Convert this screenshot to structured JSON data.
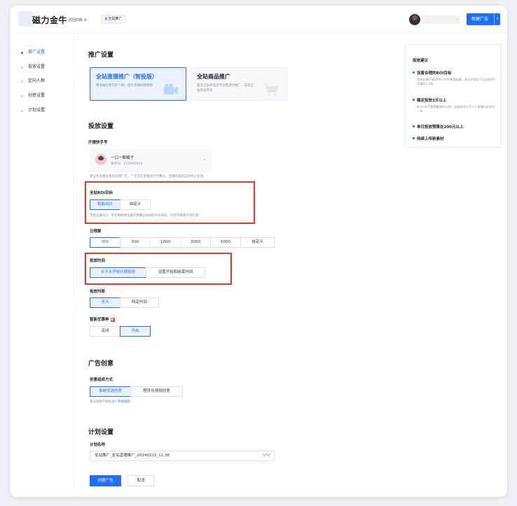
{
  "header": {
    "brand": "磁力金牛",
    "back_link": "返回旧版 ⇄",
    "mode_tag": "全站推广",
    "new_ad_label": "新建广告",
    "new_ad_caret": "▾",
    "user_caret": "⌄"
  },
  "sidebar": {
    "items": [
      {
        "label": "推广设置",
        "active": true
      },
      {
        "label": "投放设置"
      },
      {
        "label": "定向人群"
      },
      {
        "label": "创意设置"
      },
      {
        "label": "计划设置"
      }
    ]
  },
  "promo": {
    "heading": "推广设置",
    "card_live": {
      "title": "全站直播推广（智投版）",
      "desc": "精准触达意向买人群，提升直播间销售额"
    },
    "card_goods": {
      "title": "全站商品推广",
      "desc": "面向全站商品自然流量进行推广，提高全站商品转化"
    }
  },
  "delivery": {
    "heading": "投放设置",
    "account_label": "开播快手号",
    "account": {
      "name": "一口一颗橘子",
      "id": "快手ID：2139950/14"
    },
    "account_hint": "建议在直播前预先创建广告，广告仅在直播进行时曝光，直播结束后自动停止投放",
    "roi": {
      "label": "全站ROI目标",
      "options": [
        "智能出价",
        "自定义"
      ],
      "hint": "无需设置ROI，平台根据你设置的预算自动调控ROI目标，为你带来最大转化量"
    },
    "budget": {
      "label": "日预算",
      "options": [
        "300",
        "500",
        "1000",
        "3000",
        "5000",
        "自定义"
      ]
    },
    "time": {
      "label": "投放时间",
      "options": [
        "从今天开始长期投放",
        "设置开始和结束时间"
      ]
    },
    "period": {
      "label": "投放时段",
      "options": [
        "全天",
        "特定时间"
      ]
    },
    "coupon": {
      "label": "智能优惠券",
      "badge": "新",
      "options": [
        "关闭",
        "开启"
      ]
    }
  },
  "creative": {
    "heading": "广告创意",
    "mode_label": "创意组成方式",
    "options": [
      "系统优选创意",
      "程序化视频创意"
    ],
    "hint_prefix": "部分视频不想投放?",
    "hint_link": "手动排除"
  },
  "plan": {
    "heading": "计划设置",
    "name_label": "计划名称",
    "name_value": "全站推广_全站直播推广_20240315_11:36",
    "name_count": "0/50",
    "create_label": "创建广告",
    "cancel_label": "取消"
  },
  "tips": {
    "title": "投放建议",
    "items": [
      {
        "head": "设置合理的ROI目标",
        "body": "投放初期下调10%~20%更易起量，建议不超过7日全站ROI均值的1.2倍"
      },
      {
        "head": "稳定投放3天以上",
        "body": "前3小时不要频繁操作计划，且投放时长不少于直播总时长的一半"
      },
      {
        "head": "单日投放预算在200元以上",
        "body": ""
      },
      {
        "head": "持续上传新素材",
        "body": ""
      }
    ]
  },
  "colors": {
    "accent": "#1f6fff",
    "highlight": "#e8362b"
  }
}
